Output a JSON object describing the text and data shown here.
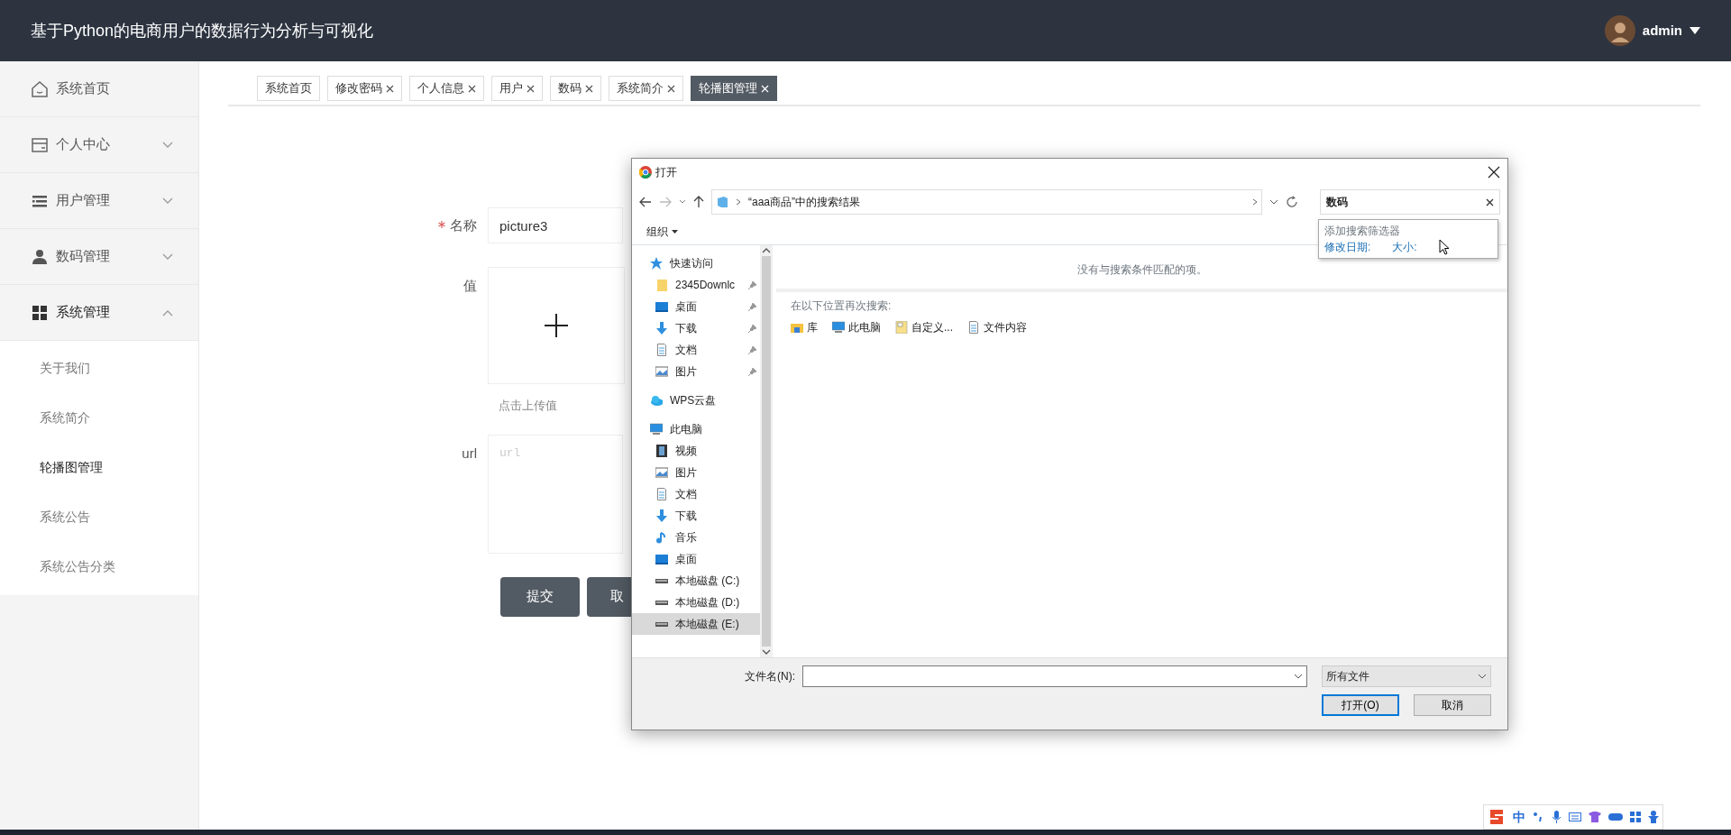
{
  "app": {
    "title": "基于Python的电商用户的数据行为分析与可视化",
    "user": "admin"
  },
  "sidebar": {
    "items": [
      {
        "label": "系统首页",
        "expandable": false,
        "expanded": false
      },
      {
        "label": "个人中心",
        "expandable": true,
        "expanded": false
      },
      {
        "label": "用户管理",
        "expandable": true,
        "expanded": false
      },
      {
        "label": "数码管理",
        "expandable": true,
        "expanded": false
      },
      {
        "label": "系统管理",
        "expandable": true,
        "expanded": true,
        "children": [
          {
            "label": "关于我们",
            "selected": false
          },
          {
            "label": "系统简介",
            "selected": false
          },
          {
            "label": "轮播图管理",
            "selected": true
          },
          {
            "label": "系统公告",
            "selected": false
          },
          {
            "label": "系统公告分类",
            "selected": false
          }
        ]
      }
    ]
  },
  "tabs": [
    {
      "label": "系统首页",
      "closable": false,
      "selected": false
    },
    {
      "label": "修改密码",
      "closable": true,
      "selected": false
    },
    {
      "label": "个人信息",
      "closable": true,
      "selected": false
    },
    {
      "label": "用户",
      "closable": true,
      "selected": false
    },
    {
      "label": "数码",
      "closable": true,
      "selected": false
    },
    {
      "label": "系统简介",
      "closable": true,
      "selected": false
    },
    {
      "label": "轮播图管理",
      "closable": true,
      "selected": true
    }
  ],
  "form": {
    "fields": [
      {
        "kind": "text",
        "label": "名称",
        "required": true,
        "value": "picture3"
      },
      {
        "kind": "upload",
        "label": "值",
        "required": false,
        "hint": "点击上传值"
      },
      {
        "kind": "textarea",
        "label": "url",
        "required": false,
        "placeholder": "url"
      }
    ],
    "buttons": [
      "提交",
      "取"
    ]
  },
  "dialog": {
    "title": "打开",
    "path": "“aaa商品”中的搜索结果",
    "search": "数码",
    "search_suggest": {
      "heading": "添加搜索筛选器",
      "filters": [
        "修改日期:",
        "大小:"
      ]
    },
    "toolbar": "组织",
    "nav": [
      {
        "label": "快速访问",
        "kind": "star",
        "selected": false,
        "children": [
          {
            "label": "2345Downlc",
            "kind": "folder",
            "pinned": true,
            "selected": false
          },
          {
            "label": "桌面",
            "kind": "desktop",
            "pinned": true,
            "selected": false
          },
          {
            "label": "下载",
            "kind": "download",
            "pinned": true,
            "selected": false
          },
          {
            "label": "文档",
            "kind": "document",
            "pinned": true,
            "selected": false
          },
          {
            "label": "图片",
            "kind": "picture",
            "pinned": true,
            "selected": false
          }
        ]
      },
      {
        "label": "WPS云盘",
        "kind": "cloud",
        "selected": false
      },
      {
        "label": "此电脑",
        "kind": "computer",
        "selected": false,
        "children": [
          {
            "label": "视频",
            "kind": "video",
            "pinned": false,
            "selected": false
          },
          {
            "label": "图片",
            "kind": "picture",
            "pinned": false,
            "selected": false
          },
          {
            "label": "文档",
            "kind": "document",
            "pinned": false,
            "selected": false
          },
          {
            "label": "下载",
            "kind": "download",
            "pinned": false,
            "selected": false
          },
          {
            "label": "音乐",
            "kind": "music",
            "pinned": false,
            "selected": false
          },
          {
            "label": "桌面",
            "kind": "desktop",
            "pinned": false,
            "selected": false
          },
          {
            "label": "本地磁盘 (C:)",
            "kind": "drive",
            "pinned": false,
            "selected": false
          },
          {
            "label": "本地磁盘 (D:)",
            "kind": "drive",
            "pinned": false,
            "selected": false
          },
          {
            "label": "本地磁盘 (E:)",
            "kind": "drive",
            "pinned": false,
            "selected": true
          }
        ]
      }
    ],
    "empty_message": "没有与搜索条件匹配的项。",
    "search_again_label": "在以下位置再次搜索:",
    "search_again": [
      {
        "label": "库",
        "kind": "library"
      },
      {
        "label": "此电脑",
        "kind": "computer"
      },
      {
        "label": "自定义...",
        "kind": "custom"
      },
      {
        "label": "文件内容",
        "kind": "document"
      }
    ],
    "filename_label": "文件名(N):",
    "filetype": "所有文件",
    "buttons": [
      "打开(O)",
      "取消"
    ]
  },
  "ime_toolbar": {
    "mode": "中"
  }
}
